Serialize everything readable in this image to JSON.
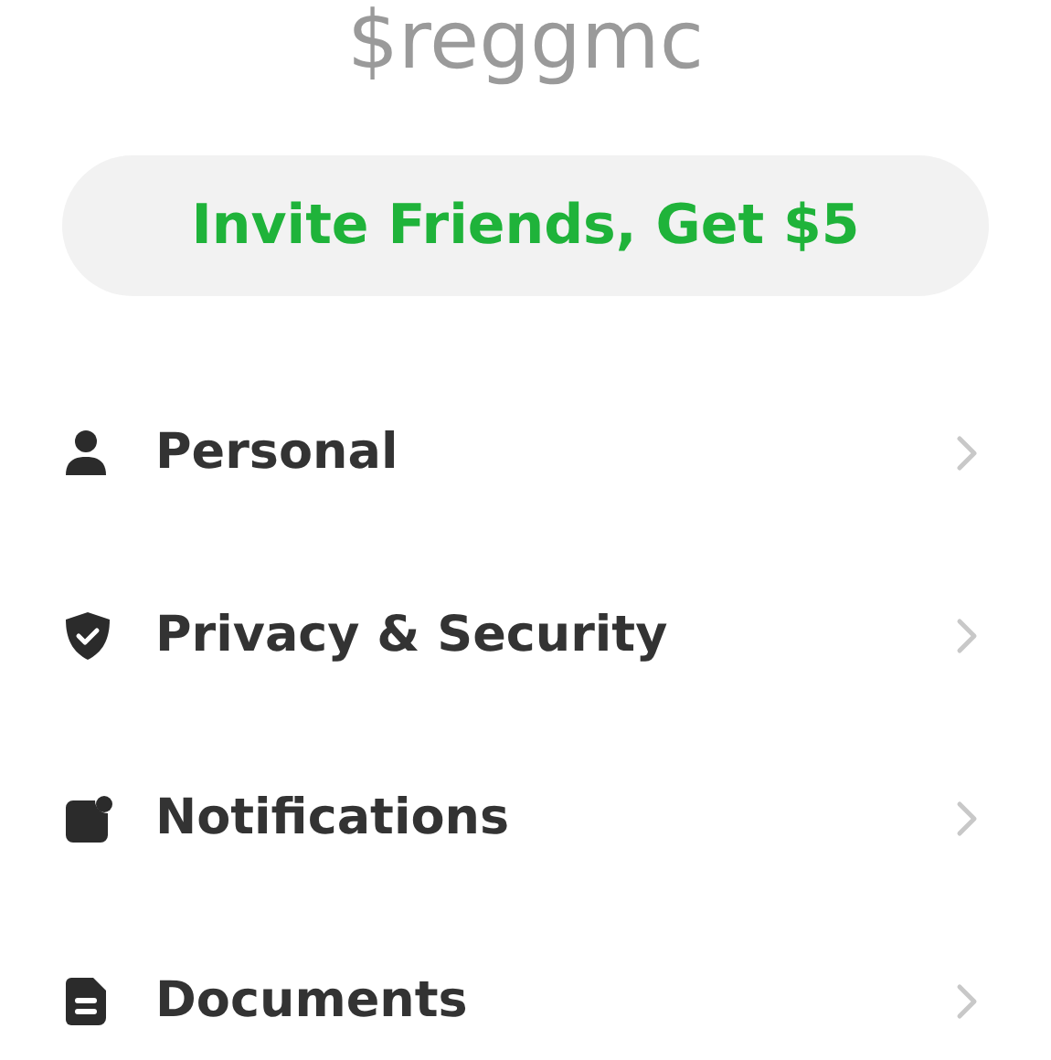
{
  "cashtag": "$reggmc",
  "invite_button": {
    "label": "Invite Friends, Get $5"
  },
  "menu": [
    {
      "kind": "person",
      "label": "Personal"
    },
    {
      "kind": "shield",
      "label": "Privacy & Security"
    },
    {
      "kind": "bell",
      "label": "Notifications"
    },
    {
      "kind": "document",
      "label": "Documents"
    }
  ]
}
